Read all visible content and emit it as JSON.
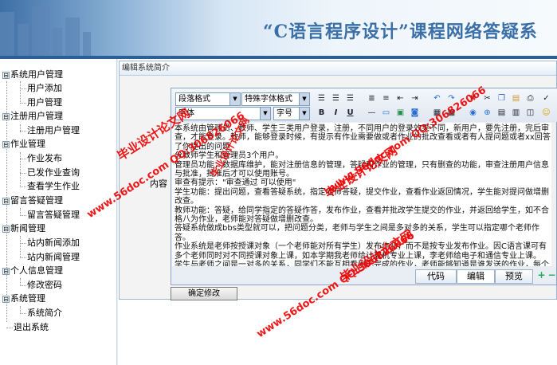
{
  "header": {
    "title": "“C语言程序设计”课程网络答疑系"
  },
  "sidebar": {
    "items": [
      {
        "label": "系统用户管理",
        "type": "group"
      },
      {
        "label": "用户添加",
        "type": "child"
      },
      {
        "label": "用户管理",
        "type": "child"
      },
      {
        "label": "注册用户管理",
        "type": "group"
      },
      {
        "label": "注册用户管理",
        "type": "child"
      },
      {
        "label": "作业管理",
        "type": "group"
      },
      {
        "label": "作业发布",
        "type": "child"
      },
      {
        "label": "已发作业查询",
        "type": "child"
      },
      {
        "label": "查看学生作业",
        "type": "child"
      },
      {
        "label": "留言答疑管理",
        "type": "group"
      },
      {
        "label": "留言答疑管理",
        "type": "child"
      },
      {
        "label": "新闻管理",
        "type": "group"
      },
      {
        "label": "站内新闻添加",
        "type": "child"
      },
      {
        "label": "站内新闻管理",
        "type": "child"
      },
      {
        "label": "个人信息管理",
        "type": "group"
      },
      {
        "label": "修改密码",
        "type": "child"
      },
      {
        "label": "系统管理",
        "type": "group"
      },
      {
        "label": "系统简介",
        "type": "child"
      },
      {
        "label": "退出系统",
        "type": "child"
      }
    ],
    "expander": "⊟"
  },
  "panel": {
    "title": "编辑系统简介",
    "content_label": "内容"
  },
  "editor": {
    "paragraph_format": "段落格式",
    "special_font": "特殊字体格式",
    "font": "字体",
    "font_size": "字号",
    "bold": "B",
    "italic": "I",
    "underline": "U",
    "text": "本系统由管理员、教师、学生三类用户登录，注册，不同用户的登录效果不同，新用户，要先注册，完后审查，才能登录。教师，能够登录时候，有提示有作业需要做或者作业的批改查看或者有人提问题或者xx回答了你提出的问题\n分教师学生和管理员3个用户。\n管理员功能：数据库维护，能对注册信息的管理，答疑和作业的管理，只有删查的功能，审查注册用户信息与批准，批准后才可以使用账号。\n审查有提示：\"审查通过 可以使用\"\n学生功能：提出问题，查看答疑系统，指定老师答疑，提交作业，查看作业返回情况，学生能对提问做增删改查。\n教师功能：答疑，给同学指定的答疑作答，发布作业，查看并批改学生提交的作业，并返回给学生，如不合格八为作业，老师能对答疑做增删改查。\n答疑系统做成bbs类型就可以，把问题分类，老师与学生之间是多对多的关系，学生可以指定哪个老师作答。\n作业系统是老师按授课对象（一个老师能对所有学生）发布作业，而不是按专业发布作业。因C语言课可有多个老师同时对不同授课对象上课，如本学期我老师给计算机专业上课，李老师给电子和通信专业上课。  学生与老师之间是一对多的关系，同学们不能互相看到已完成的作业，老师能够知道是谁发送的作业，每个同学只能看见自己的作业批改，老师收到作业批改完后并返回给学生，如不合格从"
  },
  "tabs": {
    "code": "代码",
    "edit": "编辑",
    "preview": "预览",
    "zoom_in": "+",
    "zoom_out": "−"
  },
  "submit_label": "确定修改",
  "watermarks": {
    "w1": "毕业设计论文网",
    "w2": "www.56doc.com  QQ:306826066",
    "w3": "毕业设计论文网",
    "w4": "www.56doc.com  QQ:306826066",
    "w5": "毕业设计论文网",
    "w6": "www.56doc.com  QQ:306826066",
    "w7": "毕业设计论文网"
  }
}
